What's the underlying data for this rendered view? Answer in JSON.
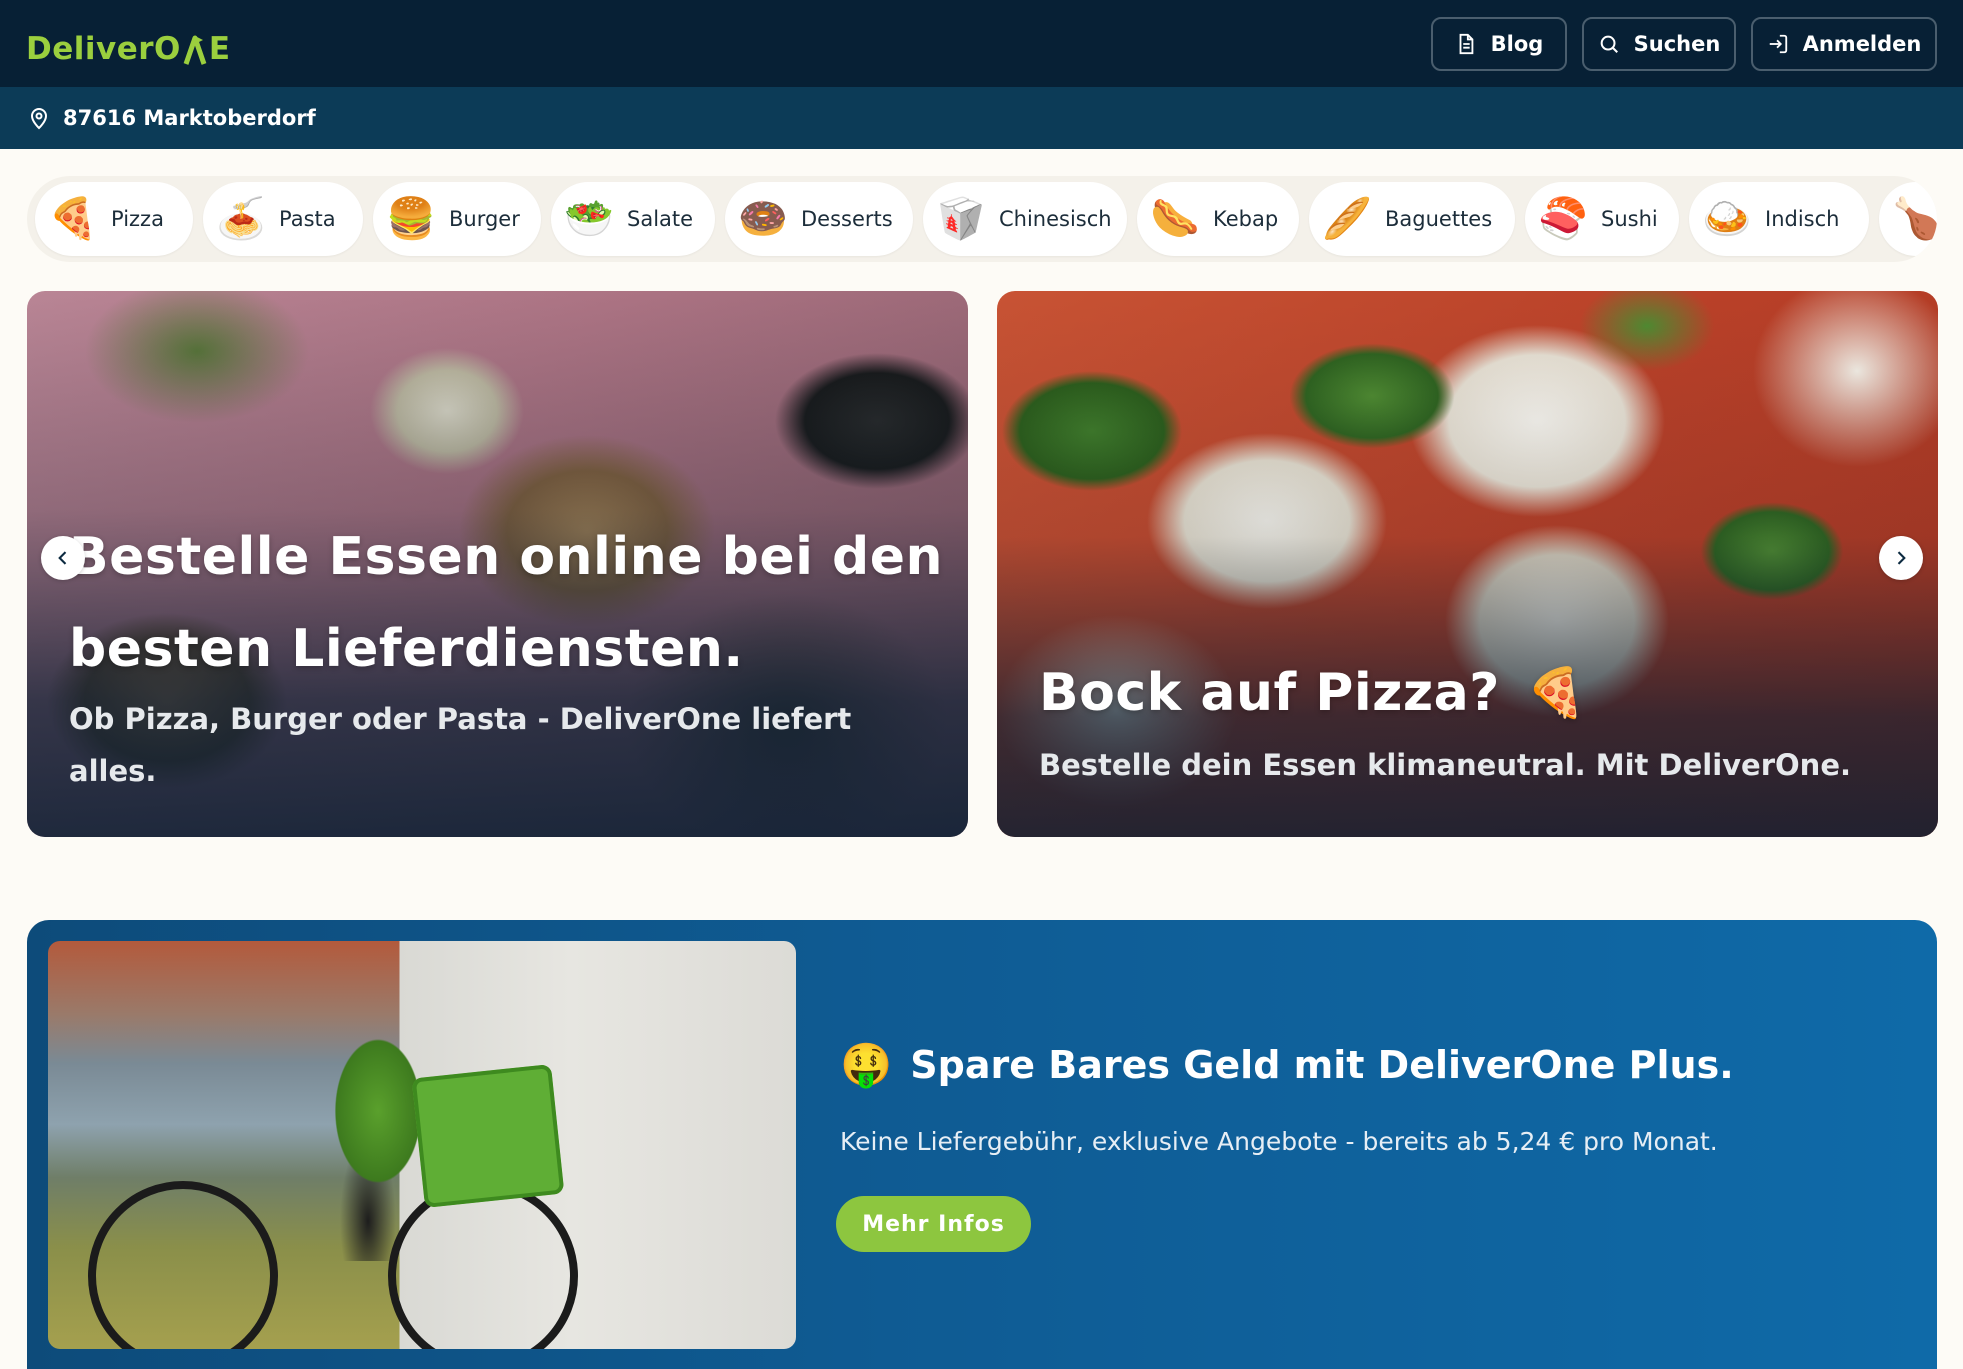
{
  "header": {
    "logo_text_a": "DeliverO",
    "logo_text_b": "E",
    "blog_label": "Blog",
    "search_label": "Suchen",
    "login_label": "Anmelden"
  },
  "location": {
    "text": "87616 Marktoberdorf"
  },
  "categories": [
    {
      "label": "Pizza",
      "emoji": "🍕"
    },
    {
      "label": "Pasta",
      "emoji": "🍝"
    },
    {
      "label": "Burger",
      "emoji": "🍔"
    },
    {
      "label": "Salate",
      "emoji": "🥗"
    },
    {
      "label": "Desserts",
      "emoji": "🍩"
    },
    {
      "label": "Chinesisch",
      "emoji": "🥡"
    },
    {
      "label": "Kebap",
      "emoji": "🌭"
    },
    {
      "label": "Baguettes",
      "emoji": "🥖"
    },
    {
      "label": "Sushi",
      "emoji": "🍣"
    },
    {
      "label": "Indisch",
      "emoji": "🍛"
    },
    {
      "label": "",
      "emoji": "🍗"
    }
  ],
  "hero": {
    "slide1": {
      "title": "Bestelle Essen online bei den besten Lieferdiensten.",
      "subtitle": "Ob Pizza, Burger oder Pasta - DeliverOne liefert alles."
    },
    "slide2": {
      "title": "Bock auf Pizza?",
      "emoji": "🍕",
      "subtitle": "Bestelle dein Essen klimaneutral. Mit DeliverOne."
    }
  },
  "promo": {
    "emoji": "🤑",
    "title": "Spare Bares Geld mit DeliverOne Plus.",
    "subtitle": "Keine Liefergebühr, exklusive Angebote - bereits ab 5,24 € pro Monat.",
    "button_label": "Mehr Infos"
  },
  "colors": {
    "header_bg": "#072035",
    "location_bg": "#0c3b57",
    "brand_green": "#9bcf3e",
    "button_green": "#8dc63f",
    "promo_blue": "#0f5b93",
    "page_bg": "#fdfbf6"
  },
  "icons": {
    "blog": "document-icon",
    "search": "search-icon",
    "login": "login-icon",
    "location": "location-pin-icon",
    "prev": "chevron-left-icon",
    "next": "chevron-right-icon"
  }
}
